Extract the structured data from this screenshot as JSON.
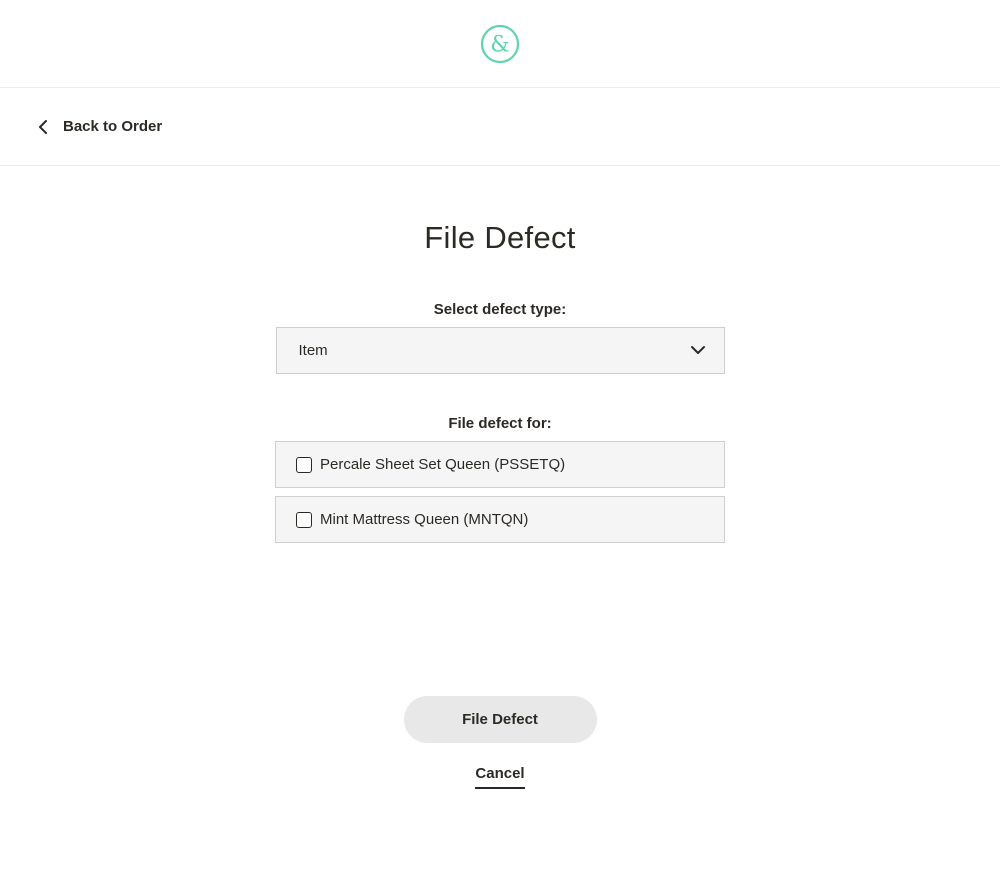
{
  "header": {
    "logo_icon": "ampersand-logo-icon",
    "logo_color": "#5cd6a9"
  },
  "nav": {
    "back_label": "Back to Order",
    "back_icon": "chevron-left-icon"
  },
  "page": {
    "title": "File Defect"
  },
  "form": {
    "defect_type_label": "Select defect type:",
    "defect_type_value": "Item",
    "defect_type_icon": "chevron-down-icon",
    "file_for_label": "File defect for:",
    "items": [
      {
        "label": "Percale Sheet Set Queen (PSSETQ)",
        "checked": false
      },
      {
        "label": "Mint Mattress Queen (MNTQN)",
        "checked": false
      }
    ]
  },
  "actions": {
    "submit_label": "File Defect",
    "cancel_label": "Cancel"
  }
}
